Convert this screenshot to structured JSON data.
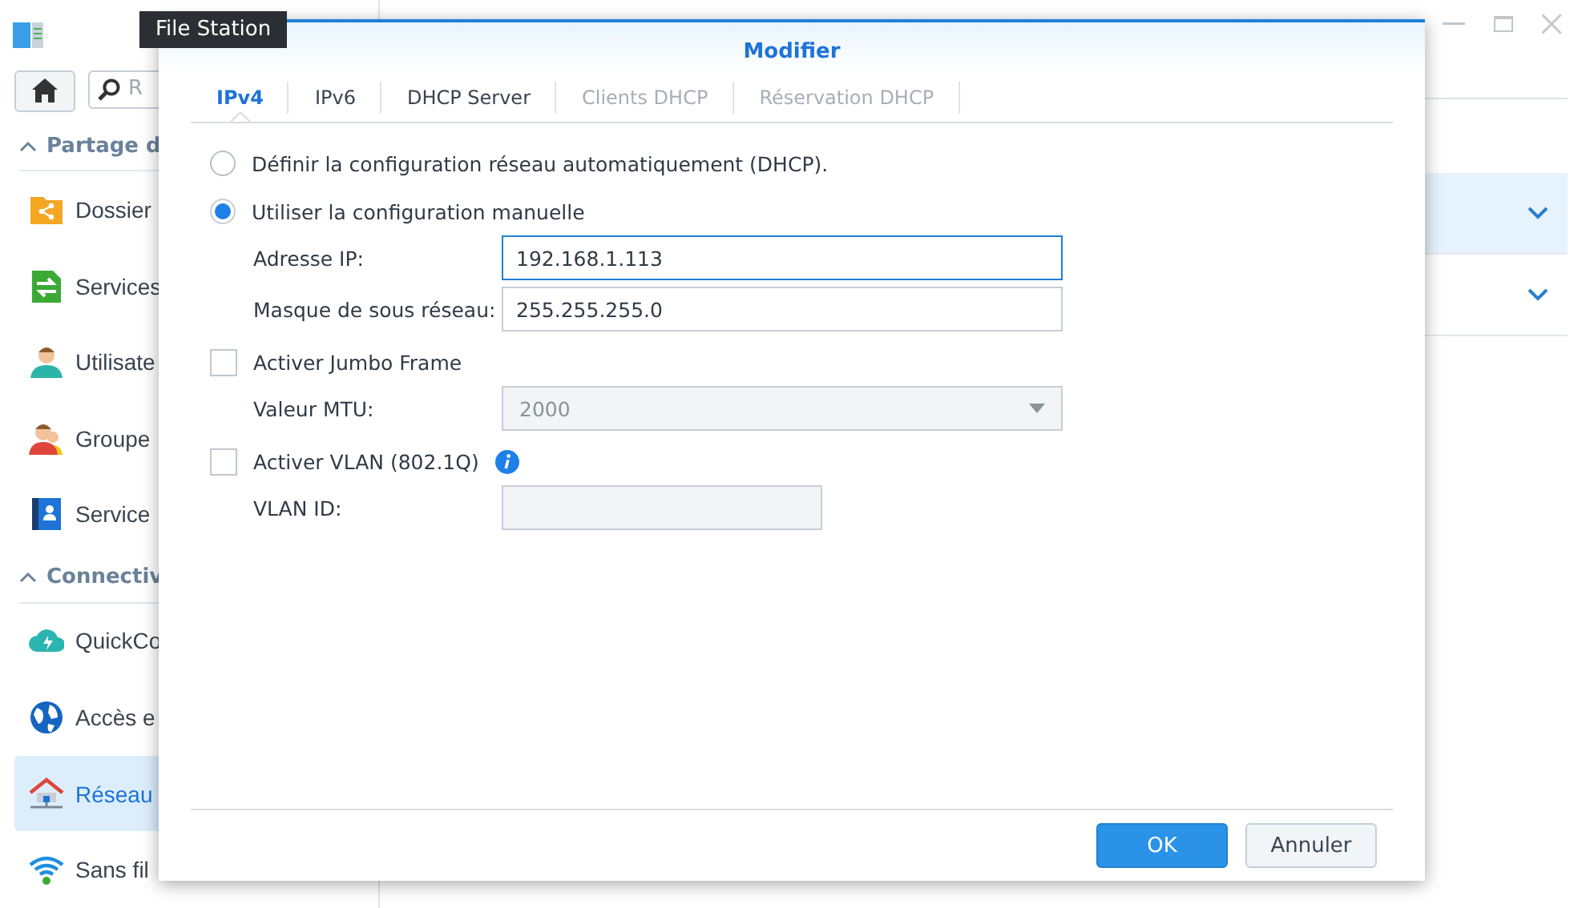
{
  "background_window": {
    "sidebar": {
      "search": {
        "placeholder": "R"
      },
      "sections": [
        {
          "title": "Partage d",
          "expanded": true,
          "items": [
            {
              "label": "Dossier",
              "kind": "folder",
              "selected": false
            },
            {
              "label": "Services",
              "kind": "services",
              "selected": false
            },
            {
              "label": "Utilisate",
              "kind": "user",
              "selected": false
            },
            {
              "label": "Groupe",
              "kind": "group",
              "selected": false
            },
            {
              "label": "Service",
              "kind": "directory",
              "selected": false
            }
          ]
        },
        {
          "title": "Connectiv",
          "expanded": true,
          "items": [
            {
              "label": "QuickCo",
              "kind": "cloud",
              "selected": false
            },
            {
              "label": "Accès e",
              "kind": "globe",
              "selected": false
            },
            {
              "label": "Réseau",
              "kind": "network",
              "selected": true
            },
            {
              "label": "Sans fil",
              "kind": "wifi",
              "selected": false
            }
          ]
        }
      ]
    },
    "rows": [
      {
        "selected": true,
        "expanded": false
      },
      {
        "selected": false,
        "expanded": false
      }
    ]
  },
  "tooltip": "File Station",
  "dialog": {
    "title": "Modifier",
    "tabs": [
      {
        "label": "IPv4",
        "selected": true,
        "disabled": false
      },
      {
        "label": "IPv6",
        "selected": false,
        "disabled": false
      },
      {
        "label": "DHCP Server",
        "selected": false,
        "disabled": false
      },
      {
        "label": "Clients DHCP",
        "selected": false,
        "disabled": true
      },
      {
        "label": "Réservation DHCP",
        "selected": false,
        "disabled": true
      }
    ],
    "form": [
      {
        "kind": "radio",
        "label": "Définir la configuration réseau automatiquement (DHCP).",
        "selected": false
      },
      {
        "kind": "radio",
        "label": "Utiliser la configuration manuelle",
        "selected": true
      },
      {
        "kind": "text",
        "label": "Adresse IP:",
        "value": "192.168.1.113",
        "focused": true,
        "disabled": false,
        "wide": true
      },
      {
        "kind": "text",
        "label": "Masque de sous réseau:",
        "value": "255.255.255.0",
        "focused": false,
        "disabled": false,
        "wide": true
      },
      {
        "kind": "checkbox",
        "label": "Activer Jumbo Frame",
        "checked": false,
        "info": false
      },
      {
        "kind": "select",
        "label": "Valeur MTU:",
        "value": "2000",
        "disabled": true
      },
      {
        "kind": "checkbox",
        "label": "Activer VLAN (802.1Q)",
        "checked": false,
        "info": true
      },
      {
        "kind": "text",
        "label": "VLAN ID:",
        "focused": false,
        "disabled": true,
        "wide": false
      }
    ],
    "buttons": [
      {
        "label": "OK",
        "primary": true
      },
      {
        "label": "Annuler",
        "primary": false
      }
    ]
  }
}
